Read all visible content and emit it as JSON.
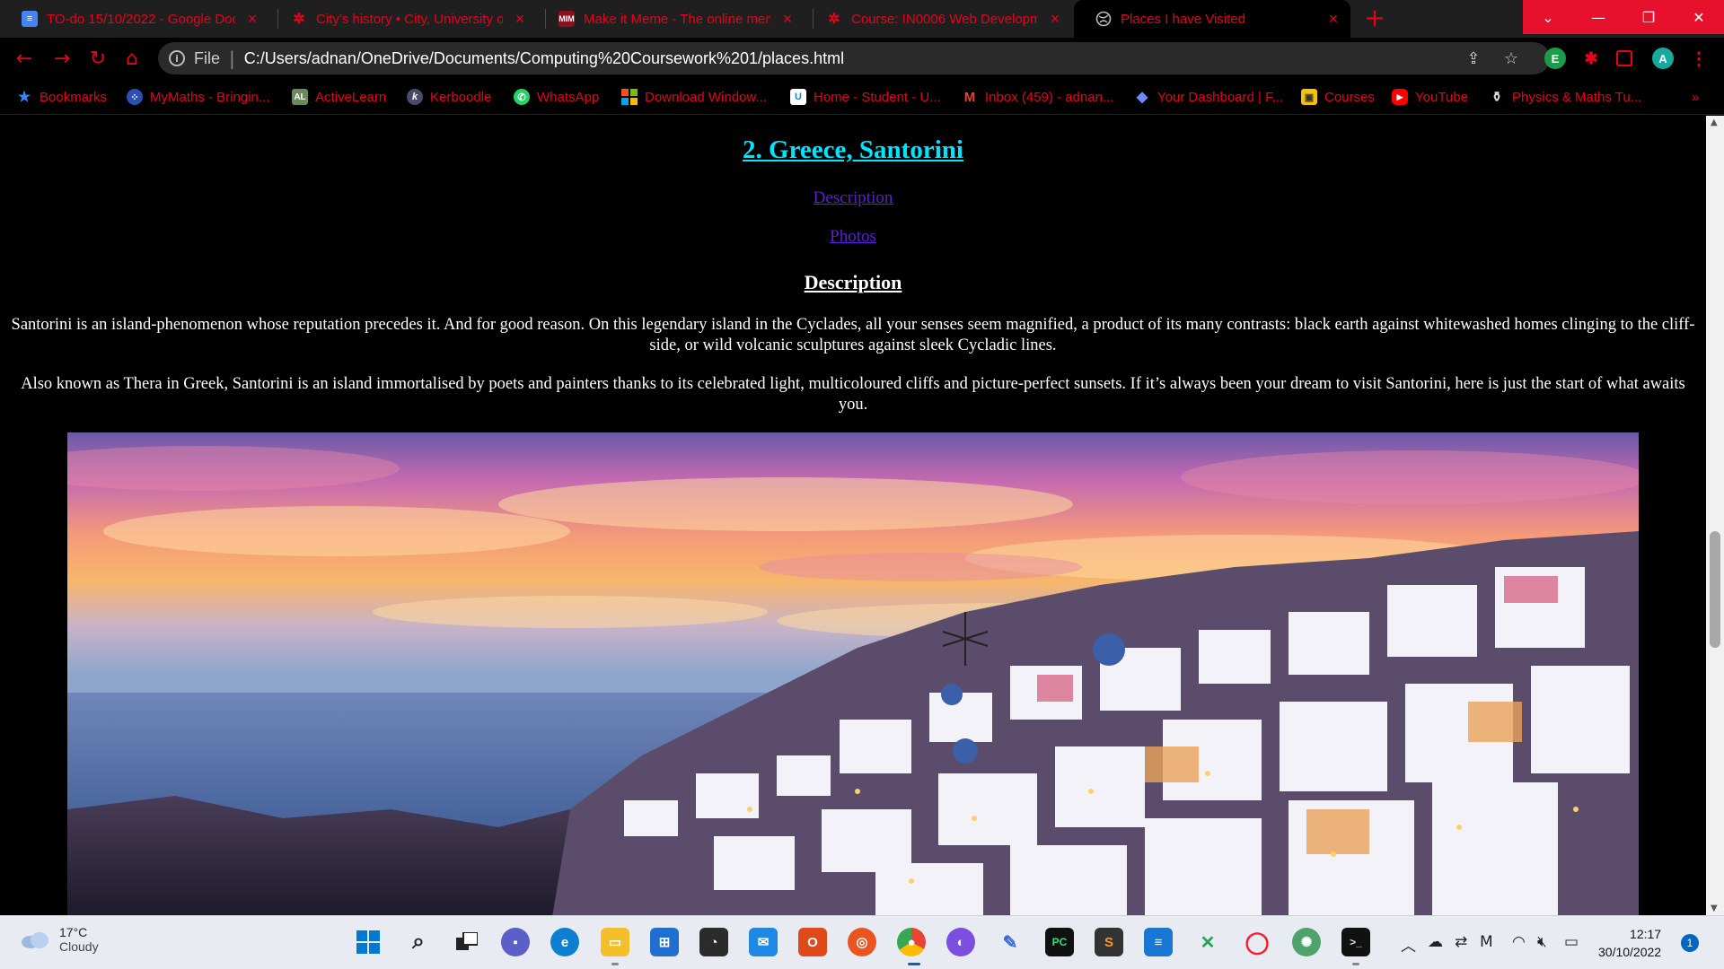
{
  "browser": {
    "tabs": [
      {
        "title": "TO-do 15/10/2022 - Google Doc",
        "icon": "google-docs-icon"
      },
      {
        "title": "City's history • City, University of",
        "icon": "city-crest-icon"
      },
      {
        "title": "Make it Meme - The online mem",
        "icon": "mim-icon",
        "icon_text": "MIM"
      },
      {
        "title": "Course: IN0006 Web Developme",
        "icon": "moodle-icon"
      },
      {
        "title": "Places I have Visited",
        "icon": "globe-icon"
      }
    ],
    "address": {
      "scheme": "File",
      "url": "C:/Users/adnan/OneDrive/Documents/Computing%20Coursework%201/places.html"
    },
    "profile_initial": "A",
    "bookmarks": [
      {
        "label": "Bookmarks",
        "icon": "star-icon"
      },
      {
        "label": "MyMaths - Bringin...",
        "icon": "mymaths-icon"
      },
      {
        "label": "ActiveLearn",
        "icon": "activelearn-icon",
        "icon_text": "AL"
      },
      {
        "label": "Kerboodle",
        "icon": "kerboodle-icon",
        "icon_text": "k"
      },
      {
        "label": "WhatsApp",
        "icon": "whatsapp-icon"
      },
      {
        "label": "Download Window...",
        "icon": "windows-icon"
      },
      {
        "label": "Home - Student - U...",
        "icon": "unifrog-icon",
        "icon_text": "U"
      },
      {
        "label": "Inbox (459) - adnan...",
        "icon": "gmail-icon",
        "icon_text": "M"
      },
      {
        "label": "Your Dashboard | F...",
        "icon": "dashboard-icon"
      },
      {
        "label": "Courses",
        "icon": "courses-icon"
      },
      {
        "label": "YouTube",
        "icon": "youtube-icon"
      },
      {
        "label": "Physics & Maths Tu...",
        "icon": "pmt-icon"
      }
    ]
  },
  "page": {
    "title": "2. Greece, Santorini",
    "toc": [
      "Description",
      "Photos"
    ],
    "section_heading": "Description",
    "paragraphs": [
      "Santorini is an island-phenomenon whose reputation precedes it. And for good reason. On this legendary island in the Cyclades, all your senses seem magnified, a product of its many contrasts: black earth against whitewashed homes clinging to the cliff-side, or wild volcanic sculptures against sleek Cycladic lines.",
      "Also known as Thera in Greek, Santorini is an island immortalised by poets and painters thanks to its celebrated light, multicoloured cliffs and picture-perfect sunsets. If it’s always been your dream to visit Santorini, here is just the start of what awaits you."
    ]
  },
  "taskbar": {
    "weather": {
      "temp": "17°C",
      "condition": "Cloudy"
    },
    "clock": {
      "time": "12:17",
      "date": "30/10/2022"
    },
    "notifications": "1"
  },
  "colors": {
    "accent": "#e8001c",
    "title_link": "#00e5ff",
    "visited_link": "#5a1fd6"
  }
}
